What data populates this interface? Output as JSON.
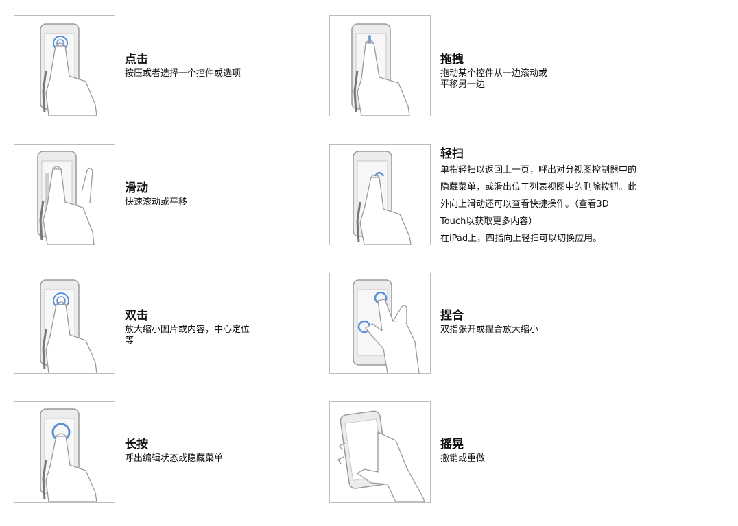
{
  "gestures": [
    {
      "title": "点击",
      "desc": "按压或者选择一个控件或选项"
    },
    {
      "title": "拖拽",
      "desc_lines": [
        "拖动某个控件从一边滚动或",
        "平移另一边"
      ]
    },
    {
      "title": "滑动",
      "desc": "快速滚动或平移"
    },
    {
      "title": "轻扫",
      "desc_lines": [
        "单指轻扫以返回上一页，呼出对分视图控制器中的",
        "隐藏菜单，或滑出位于列表视图中的删除按钮。此",
        "外向上滑动还可以查看快捷操作。（查看3D",
        "Touch以获取更多内容）",
        "在iPad上，四指向上轻扫可以切换应用。"
      ]
    },
    {
      "title": "双击",
      "desc_lines": [
        "放大缩小图片或内容，中心定位",
        "等"
      ]
    },
    {
      "title": "捏合",
      "desc": "双指张开或捏合放大缩小"
    },
    {
      "title": "长按",
      "desc": "呼出编辑状态或隐藏菜单"
    },
    {
      "title": "摇晃",
      "desc": "撤销或重做"
    }
  ],
  "colors": {
    "accent_blue": "#5b8fd6",
    "line_gray": "#9a9a9a",
    "phone_fill": "#ececec"
  }
}
